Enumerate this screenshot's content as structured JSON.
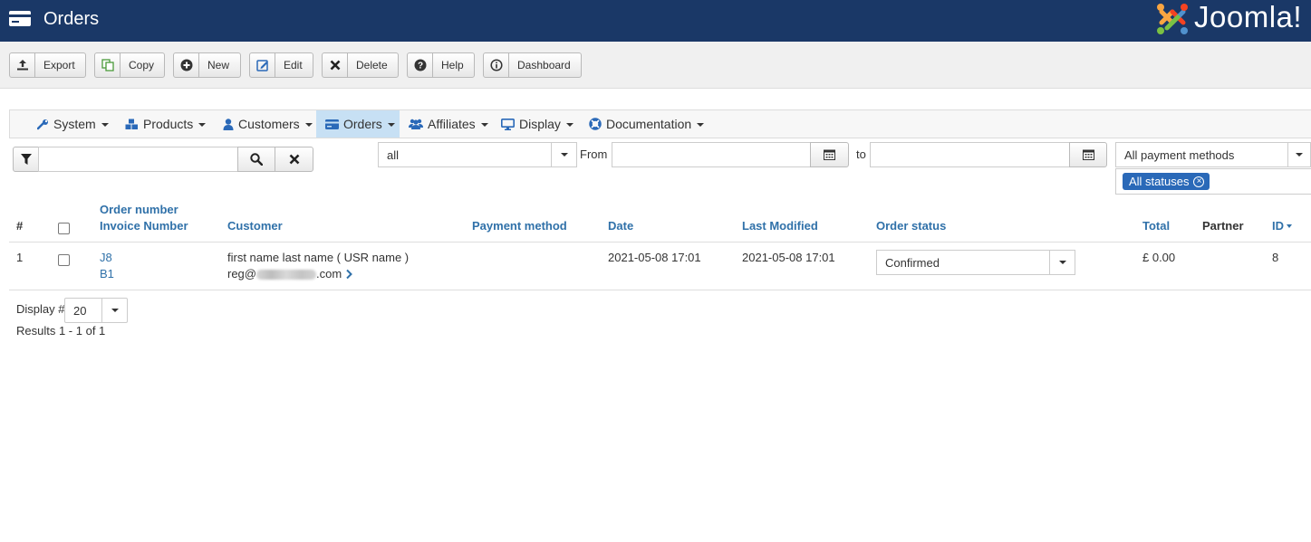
{
  "header": {
    "title": "Orders",
    "brand": "Joomla!"
  },
  "toolbar": {
    "buttons": [
      {
        "label": "Export",
        "icon": "upload-icon"
      },
      {
        "label": "Copy",
        "icon": "copy-icon"
      },
      {
        "label": "New",
        "icon": "plus-circle-icon"
      },
      {
        "label": "Edit",
        "icon": "edit-icon"
      },
      {
        "label": "Delete",
        "icon": "x-icon"
      },
      {
        "label": "Help",
        "icon": "question-circle-icon"
      },
      {
        "label": "Dashboard",
        "icon": "info-circle-icon"
      }
    ]
  },
  "menu": {
    "items": [
      {
        "label": "System",
        "icon": "wrench-icon"
      },
      {
        "label": "Products",
        "icon": "cubes-icon"
      },
      {
        "label": "Customers",
        "icon": "user-icon"
      },
      {
        "label": "Orders",
        "icon": "credit-card-icon",
        "active": true
      },
      {
        "label": "Affiliates",
        "icon": "users-icon"
      },
      {
        "label": "Display",
        "icon": "monitor-icon"
      },
      {
        "label": "Documentation",
        "icon": "lifebuoy-icon"
      }
    ]
  },
  "filters": {
    "search_value": "",
    "period_select": "all",
    "from_label": "From",
    "from_value": "",
    "to_label": "to",
    "to_value": "",
    "payment_select": "All payment methods",
    "status_tag": "All statuses"
  },
  "table": {
    "headers": {
      "num": "#",
      "order_number": "Order number",
      "invoice_number": "Invoice Number",
      "customer": "Customer",
      "payment_method": "Payment method",
      "date": "Date",
      "last_modified": "Last Modified",
      "order_status": "Order status",
      "total": "Total",
      "partner": "Partner",
      "id": "ID"
    },
    "rows": [
      {
        "num": "1",
        "order_number": "J8",
        "invoice_number": "B1",
        "customer_name": "first name last name ( USR name )",
        "email_prefix": "reg@",
        "email_suffix": ".com",
        "payment_method": "",
        "date": "2021-05-08 17:01",
        "last_modified": "2021-05-08 17:01",
        "status": "Confirmed",
        "total": "£ 0.00",
        "partner": "",
        "id": "8"
      }
    ]
  },
  "footer": {
    "display_label": "Display #",
    "display_value": "20",
    "results": "Results 1 - 1 of 1"
  },
  "colors": {
    "header_bg": "#1a3867",
    "link": "#3071a9",
    "active_menu_bg": "#c7e0f4",
    "status_tag_bg": "#2a69b8"
  }
}
